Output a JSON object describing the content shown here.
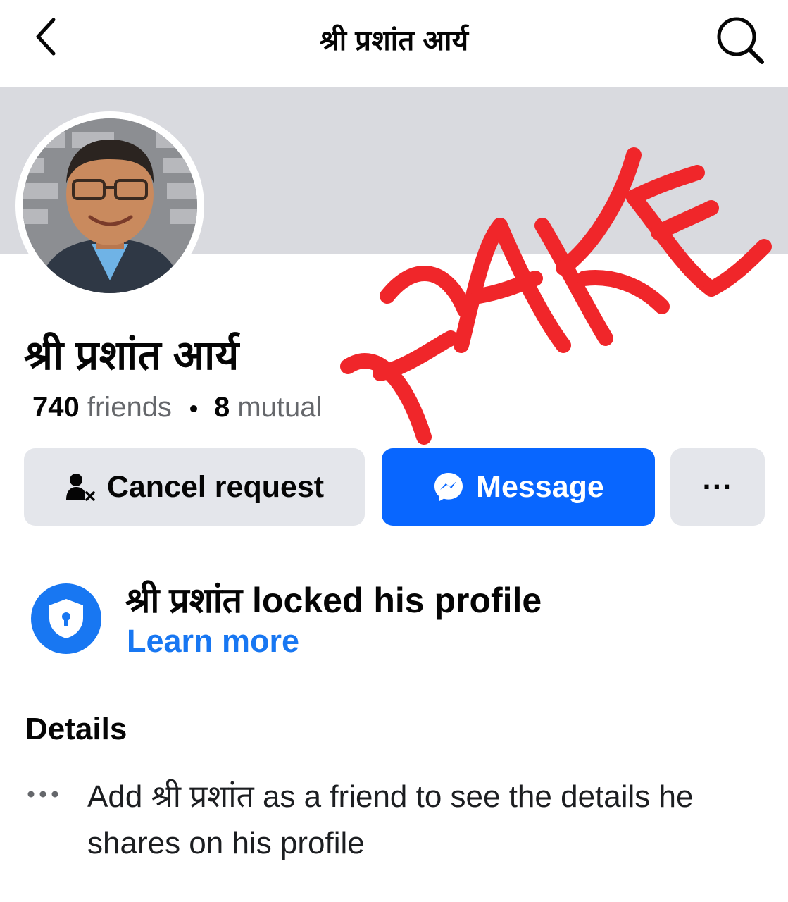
{
  "header": {
    "title": "श्री प्रशांत आर्य",
    "back_icon": "chevron-left-icon",
    "search_icon": "search-icon"
  },
  "profile": {
    "name": "श्री प्रशांत आर्य",
    "friends_count": "740",
    "friends_label": "friends",
    "mutual_count": "8",
    "mutual_label": "mutual"
  },
  "actions": {
    "cancel_label": "Cancel request",
    "cancel_icon": "person-x-icon",
    "message_label": "Message",
    "message_icon": "messenger-icon",
    "more_label": "···",
    "more_icon": "more-icon"
  },
  "locked": {
    "title": "श्री प्रशांत locked his profile",
    "learn_more": "Learn more",
    "icon": "shield-lock-icon"
  },
  "details": {
    "heading": "Details",
    "text": "Add श्री प्रशांत as a friend to see the details he shares on his profile",
    "icon": "more-dots-icon"
  },
  "overlay": {
    "stamp_text": "FAKE"
  },
  "colors": {
    "accent": "#0866ff",
    "link": "#1877f2",
    "button_gray": "#e4e6eb",
    "cover_gray": "#d9dadf",
    "stamp_red": "#f0262a"
  }
}
